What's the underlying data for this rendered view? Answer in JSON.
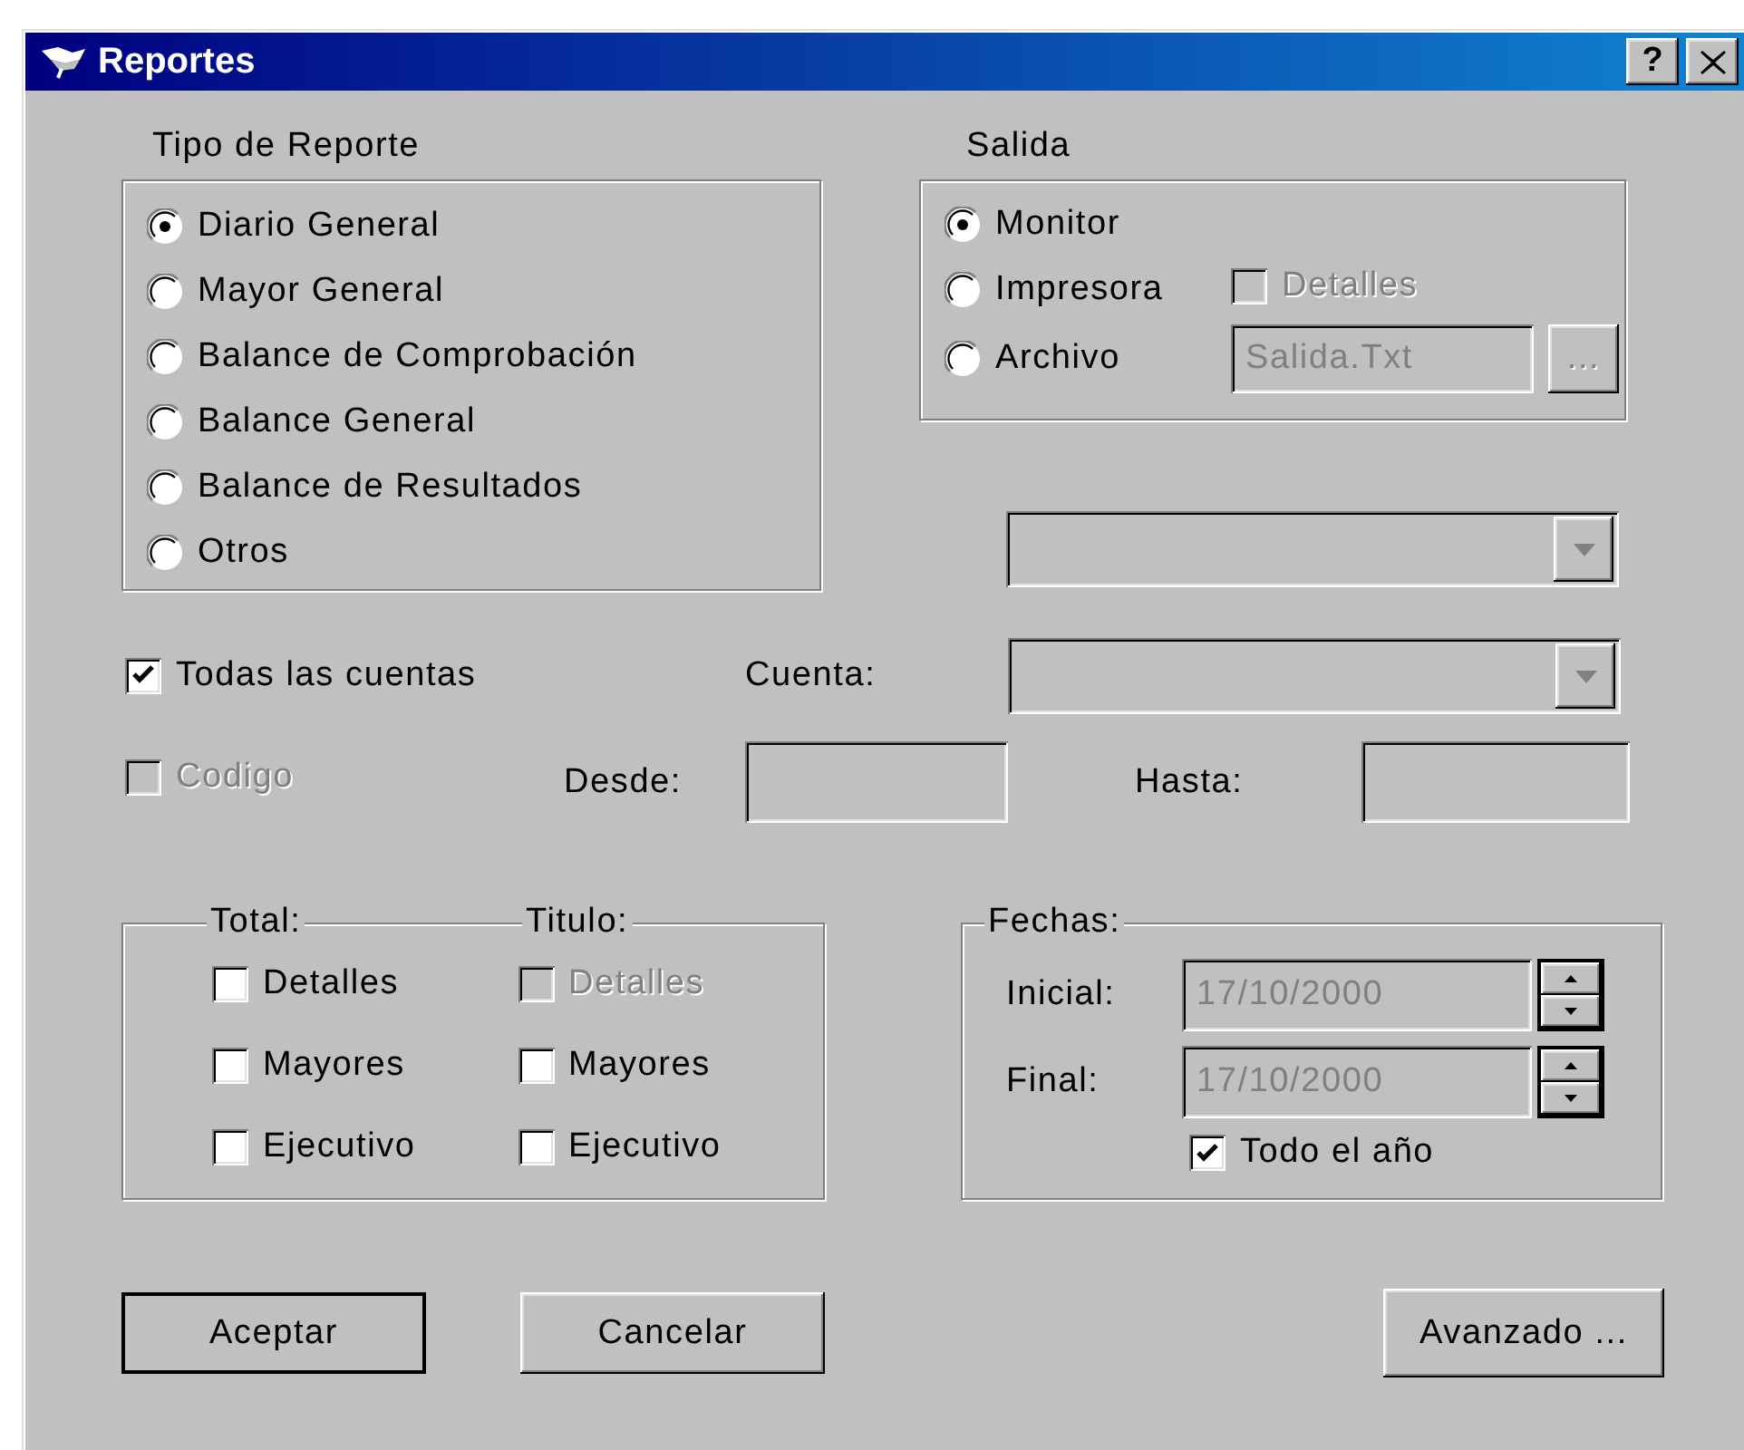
{
  "window": {
    "title": "Reportes",
    "buttons": [
      {
        "kind": "help",
        "label": "?"
      },
      {
        "kind": "close"
      }
    ]
  },
  "report_type": {
    "label": "Tipo de Reporte",
    "options": [
      {
        "label": "Diario General",
        "selected": true
      },
      {
        "label": "Mayor General",
        "selected": false
      },
      {
        "label": "Balance de Comprobación",
        "selected": false
      },
      {
        "label": "Balance General",
        "selected": false
      },
      {
        "label": "Balance de Resultados",
        "selected": false
      },
      {
        "label": "Otros",
        "selected": false
      }
    ]
  },
  "output": {
    "label": "Salida",
    "options": [
      {
        "label": "Monitor",
        "selected": true
      },
      {
        "label": "Impresora",
        "selected": false
      },
      {
        "label": "Archivo",
        "selected": false
      }
    ],
    "details": {
      "label": "Detalles",
      "checked": false,
      "disabled": true
    },
    "file": {
      "value": "Salida.Txt",
      "disabled": true
    },
    "browse_button": {
      "label": "...",
      "disabled": true
    }
  },
  "other_combo": {
    "disabled": true
  },
  "all_accounts": {
    "label": "Todas las cuentas",
    "checked": true,
    "disabled": false
  },
  "account": {
    "label": "Cuenta:",
    "disabled": true
  },
  "code": {
    "label": "Codigo",
    "checked": false,
    "disabled": true
  },
  "from": {
    "label": "Desde:",
    "disabled": true
  },
  "to": {
    "label": "Hasta:",
    "disabled": true
  },
  "totals": {
    "columns": [
      {
        "label": "Total:",
        "items": [
          {
            "label": "Detalles",
            "checked": false,
            "disabled": false
          },
          {
            "label": "Mayores",
            "checked": false,
            "disabled": false
          },
          {
            "label": "Ejecutivo",
            "checked": false,
            "disabled": false
          }
        ]
      },
      {
        "label": "Titulo:",
        "items": [
          {
            "label": "Detalles",
            "checked": false,
            "disabled": true
          },
          {
            "label": "Mayores",
            "checked": false,
            "disabled": false
          },
          {
            "label": "Ejecutivo",
            "checked": false,
            "disabled": false
          }
        ]
      }
    ]
  },
  "dates": {
    "label": "Fechas:",
    "fields": [
      {
        "label": "Inicial:",
        "value": "17/10/2000",
        "disabled": true
      },
      {
        "label": "Final:",
        "value": "17/10/2000",
        "disabled": true
      }
    ],
    "whole_year": {
      "label": "Todo el año",
      "checked": true,
      "disabled": false
    }
  },
  "buttons": [
    {
      "label": "Aceptar",
      "default": true
    },
    {
      "label": "Cancelar",
      "default": false
    },
    {
      "label": "Avanzado ...",
      "default": false
    }
  ]
}
